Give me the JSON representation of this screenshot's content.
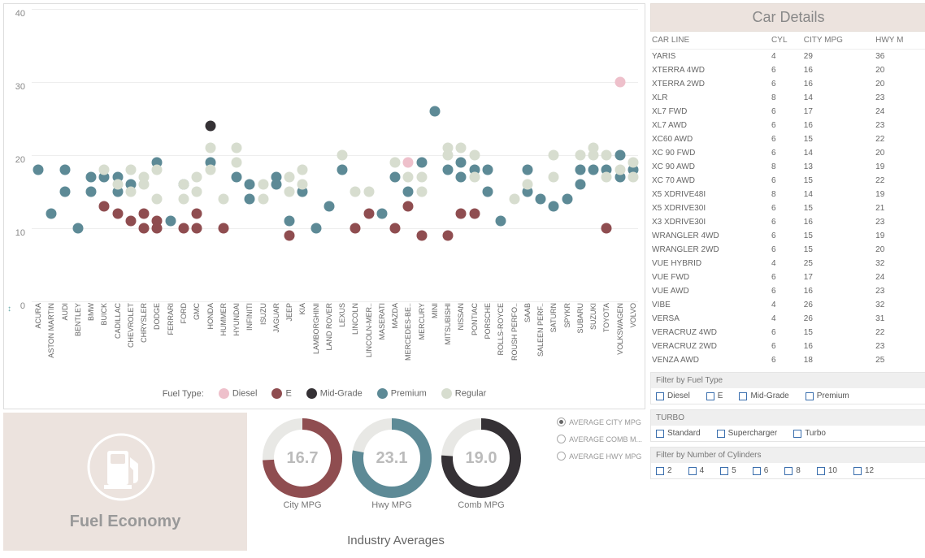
{
  "chart_data": {
    "type": "scatter",
    "title": "",
    "ylabel": "",
    "xlabel": "",
    "ylim": [
      0,
      40
    ],
    "yticks": [
      0,
      10,
      20,
      30,
      40
    ],
    "categories": [
      "ACURA",
      "ASTON MARTIN",
      "AUDI",
      "BENTLEY",
      "BMW",
      "BUICK",
      "CADILLAC",
      "CHEVROLET",
      "CHRYSLER",
      "DODGE",
      "FERRARI",
      "FORD",
      "GMC",
      "HONDA",
      "HUMMER",
      "HYUNDAI",
      "INFINITI",
      "ISUZU",
      "JAGUAR",
      "JEEP",
      "KIA",
      "LAMBORGHINI",
      "LAND ROVER",
      "LEXUS",
      "LINCOLN",
      "LINCOLN-MER..",
      "MASERATI",
      "MAZDA",
      "MERCEDES-BE..",
      "MERCURY",
      "MINI",
      "MITSUBISHI",
      "NISSAN",
      "PONTIAC",
      "PORSCHE",
      "ROLLS-ROYCE",
      "ROUSH PERFO..",
      "SAAB",
      "SALEEN PERF..",
      "SATURN",
      "SPYKR",
      "SUBARU",
      "SUZUKI",
      "TOYOTA",
      "VOLKSWAGEN",
      "VOLVO"
    ],
    "series": [
      {
        "name": "Diesel",
        "color": "#eec0cb",
        "points": [
          [
            "MERCEDES-BE..",
            19
          ],
          [
            "VOLKSWAGEN",
            30
          ]
        ]
      },
      {
        "name": "E",
        "color": "#8f4d50",
        "points": [
          [
            "BUICK",
            13
          ],
          [
            "CADILLAC",
            12
          ],
          [
            "CHEVROLET",
            11
          ],
          [
            "CHRYSLER",
            12
          ],
          [
            "CHRYSLER",
            10
          ],
          [
            "DODGE",
            11
          ],
          [
            "DODGE",
            10
          ],
          [
            "FORD",
            10
          ],
          [
            "GMC",
            12
          ],
          [
            "GMC",
            10
          ],
          [
            "HUMMER",
            10
          ],
          [
            "JEEP",
            9
          ],
          [
            "LINCOLN",
            10
          ],
          [
            "LINCOLN-MER..",
            12
          ],
          [
            "MAZDA",
            10
          ],
          [
            "MERCEDES-BE..",
            13
          ],
          [
            "MERCURY",
            9
          ],
          [
            "MITSUBISHI",
            9
          ],
          [
            "NISSAN",
            12
          ],
          [
            "PONTIAC",
            12
          ],
          [
            "TOYOTA",
            10
          ]
        ]
      },
      {
        "name": "Mid-Grade",
        "color": "#353135",
        "points": [
          [
            "HONDA",
            24
          ]
        ]
      },
      {
        "name": "Premium",
        "color": "#5d8a96",
        "points": [
          [
            "ACURA",
            18
          ],
          [
            "ASTON MARTIN",
            12
          ],
          [
            "AUDI",
            18
          ],
          [
            "AUDI",
            15
          ],
          [
            "BENTLEY",
            10
          ],
          [
            "BMW",
            15
          ],
          [
            "BMW",
            17
          ],
          [
            "BUICK",
            17
          ],
          [
            "CADILLAC",
            15
          ],
          [
            "CADILLAC",
            17
          ],
          [
            "CHEVROLET",
            16
          ],
          [
            "DODGE",
            19
          ],
          [
            "FERRARI",
            11
          ],
          [
            "FORD",
            16
          ],
          [
            "HONDA",
            19
          ],
          [
            "HYUNDAI",
            17
          ],
          [
            "INFINITI",
            16
          ],
          [
            "INFINITI",
            14
          ],
          [
            "JAGUAR",
            17
          ],
          [
            "JAGUAR",
            16
          ],
          [
            "JEEP",
            11
          ],
          [
            "KIA",
            15
          ],
          [
            "LAMBORGHINI",
            10
          ],
          [
            "LAND ROVER",
            13
          ],
          [
            "LEXUS",
            18
          ],
          [
            "MASERATI",
            12
          ],
          [
            "MAZDA",
            17
          ],
          [
            "MERCEDES-BE..",
            15
          ],
          [
            "MERCURY",
            19
          ],
          [
            "MINI",
            26
          ],
          [
            "MITSUBISHI",
            18
          ],
          [
            "NISSAN",
            19
          ],
          [
            "NISSAN",
            17
          ],
          [
            "PONTIAC",
            18
          ],
          [
            "PORSCHE",
            18
          ],
          [
            "PORSCHE",
            15
          ],
          [
            "ROLLS-ROYCE",
            11
          ],
          [
            "SAAB",
            18
          ],
          [
            "SAAB",
            15
          ],
          [
            "SALEEN PERF..",
            14
          ],
          [
            "SATURN",
            13
          ],
          [
            "SPYKR",
            14
          ],
          [
            "SUBARU",
            18
          ],
          [
            "SUBARU",
            16
          ],
          [
            "SUZUKI",
            18
          ],
          [
            "TOYOTA",
            18
          ],
          [
            "VOLKSWAGEN",
            20
          ],
          [
            "VOLKSWAGEN",
            17
          ],
          [
            "VOLVO",
            18
          ]
        ]
      },
      {
        "name": "Regular",
        "color": "#d7ddcf",
        "points": [
          [
            "BUICK",
            18
          ],
          [
            "CADILLAC",
            16
          ],
          [
            "CHEVROLET",
            18
          ],
          [
            "CHEVROLET",
            15
          ],
          [
            "CHRYSLER",
            17
          ],
          [
            "CHRYSLER",
            16
          ],
          [
            "DODGE",
            18
          ],
          [
            "DODGE",
            14
          ],
          [
            "FORD",
            16
          ],
          [
            "FORD",
            14
          ],
          [
            "GMC",
            17
          ],
          [
            "GMC",
            15
          ],
          [
            "HONDA",
            21
          ],
          [
            "HONDA",
            18
          ],
          [
            "HUMMER",
            14
          ],
          [
            "HYUNDAI",
            19
          ],
          [
            "HYUNDAI",
            21
          ],
          [
            "ISUZU",
            16
          ],
          [
            "ISUZU",
            14
          ],
          [
            "JEEP",
            17
          ],
          [
            "JEEP",
            15
          ],
          [
            "KIA",
            18
          ],
          [
            "KIA",
            16
          ],
          [
            "LEXUS",
            20
          ],
          [
            "LINCOLN",
            15
          ],
          [
            "LINCOLN-MER..",
            15
          ],
          [
            "MAZDA",
            19
          ],
          [
            "MERCEDES-BE..",
            17
          ],
          [
            "MERCURY",
            17
          ],
          [
            "MERCURY",
            15
          ],
          [
            "MITSUBISHI",
            21
          ],
          [
            "MITSUBISHI",
            20
          ],
          [
            "NISSAN",
            21
          ],
          [
            "PONTIAC",
            20
          ],
          [
            "PONTIAC",
            17
          ],
          [
            "ROUSH PERFO..",
            14
          ],
          [
            "SAAB",
            16
          ],
          [
            "SATURN",
            20
          ],
          [
            "SATURN",
            17
          ],
          [
            "SUBARU",
            20
          ],
          [
            "SUZUKI",
            20
          ],
          [
            "SUZUKI",
            21
          ],
          [
            "TOYOTA",
            20
          ],
          [
            "TOYOTA",
            17
          ],
          [
            "VOLKSWAGEN",
            18
          ],
          [
            "VOLVO",
            19
          ],
          [
            "VOLVO",
            17
          ]
        ]
      }
    ],
    "legend_label": "Fuel Type:"
  },
  "details": {
    "title": "Car Details",
    "columns": [
      "CAR LINE",
      "CYL",
      "CITY MPG",
      "HWY M"
    ],
    "rows": [
      [
        "YARIS",
        4,
        29,
        36
      ],
      [
        "XTERRA 4WD",
        6,
        16,
        20
      ],
      [
        "XTERRA 2WD",
        6,
        16,
        20
      ],
      [
        "XLR",
        8,
        14,
        23
      ],
      [
        "XL7 FWD",
        6,
        17,
        24
      ],
      [
        "XL7 AWD",
        6,
        16,
        23
      ],
      [
        "XC60 AWD",
        6,
        15,
        22
      ],
      [
        "XC 90 FWD",
        6,
        14,
        20
      ],
      [
        "XC 90 AWD",
        8,
        13,
        19
      ],
      [
        "XC 70 AWD",
        6,
        15,
        22
      ],
      [
        "X5 XDRIVE48I",
        8,
        14,
        19
      ],
      [
        "X5 XDRIVE30I",
        6,
        15,
        21
      ],
      [
        "X3 XDRIVE30I",
        6,
        16,
        23
      ],
      [
        "WRANGLER 4WD",
        6,
        15,
        19
      ],
      [
        "WRANGLER 2WD",
        6,
        15,
        20
      ],
      [
        "VUE HYBRID",
        4,
        25,
        32
      ],
      [
        "VUE FWD",
        6,
        17,
        24
      ],
      [
        "VUE AWD",
        6,
        16,
        23
      ],
      [
        "VIBE",
        4,
        26,
        32
      ],
      [
        "VERSA",
        4,
        26,
        31
      ],
      [
        "VERACRUZ 4WD",
        6,
        15,
        22
      ],
      [
        "VERACRUZ 2WD",
        6,
        16,
        23
      ],
      [
        "VENZA AWD",
        6,
        18,
        25
      ]
    ]
  },
  "averages": {
    "title": "Industry Averages",
    "donuts": [
      {
        "label": "City MPG",
        "value": "16.7",
        "frac": 0.74,
        "color": "#8f4d50"
      },
      {
        "label": "Hwy MPG",
        "value": "23.1",
        "frac": 0.78,
        "color": "#5d8a96"
      },
      {
        "label": "Comb MPG",
        "value": "19.0",
        "frac": 0.76,
        "color": "#353135"
      }
    ],
    "radios": [
      {
        "label": "AVERAGE CITY MPG",
        "selected": true
      },
      {
        "label": "AVERAGE COMB M...",
        "selected": false
      },
      {
        "label": "AVERAGE HWY MPG",
        "selected": false
      }
    ]
  },
  "fuel_card": {
    "title": "Fuel Economy"
  },
  "filters": {
    "fuel": {
      "title": "Filter by Fuel Type",
      "opts": [
        "Diesel",
        "E",
        "Mid-Grade",
        "Premium"
      ]
    },
    "turbo": {
      "title": "TURBO",
      "opts": [
        "Standard",
        "Supercharger",
        "Turbo"
      ]
    },
    "cyl": {
      "title": "Filter by Number of Cylinders",
      "opts": [
        "2",
        "4",
        "5",
        "6",
        "8",
        "10",
        "12"
      ]
    }
  }
}
